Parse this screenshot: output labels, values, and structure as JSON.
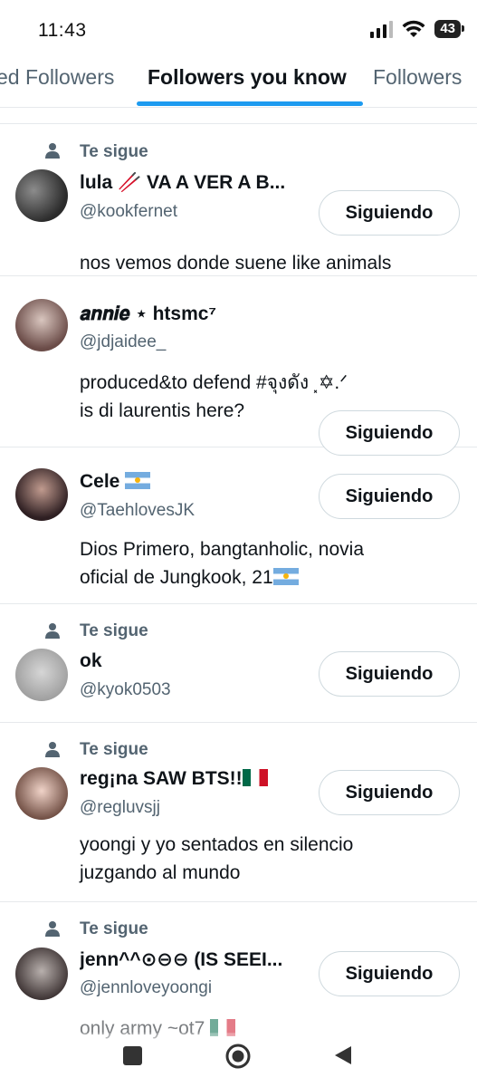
{
  "status_bar": {
    "time": "11:43",
    "battery": "43"
  },
  "tabs": {
    "left": "ed Followers",
    "active": "Followers you know",
    "right": "Followers"
  },
  "follows_label": "Te sigue",
  "follow_button_label": "Siguiendo",
  "users": [
    {
      "name": "lula 🥢 VA A VER A B...",
      "handle": "@kookfernet",
      "bio": "nos vemos donde suene like animals",
      "follows_you": true
    },
    {
      "name": "𝒂𝒏𝒏𝒊𝒆 ⋆ htsmc⁷",
      "handle": "@jdjaidee_",
      "bio_line1": "produced&to defend #จุงดัง ⸼✡︎.ᐟ",
      "bio_line2": "is di laurentis here?",
      "follows_you": false
    },
    {
      "name": "Cele",
      "handle": "@TaehlovesJK",
      "bio_line1": "Dios Primero, bangtanholic, novia",
      "bio_line2": "oficial de Jungkook, 21",
      "follows_you": false
    },
    {
      "name": "ok",
      "handle": "@kyok0503",
      "follows_you": true
    },
    {
      "name": "reg¡na SAW BTS!!",
      "handle": "@regluvsjj",
      "bio_line1": "yoongi y yo sentados en silencio",
      "bio_line2": "juzgando al mundo",
      "follows_you": true
    },
    {
      "name": "jenn^^⊙⊖⊖ (IS SEEI...",
      "handle": "@jennloveyoongi",
      "bio": "only army ~ot7",
      "follows_you": true
    }
  ],
  "colors": {
    "accent": "#1d9bf0",
    "secondary_text": "#536471",
    "divider": "#e6e9ec"
  }
}
